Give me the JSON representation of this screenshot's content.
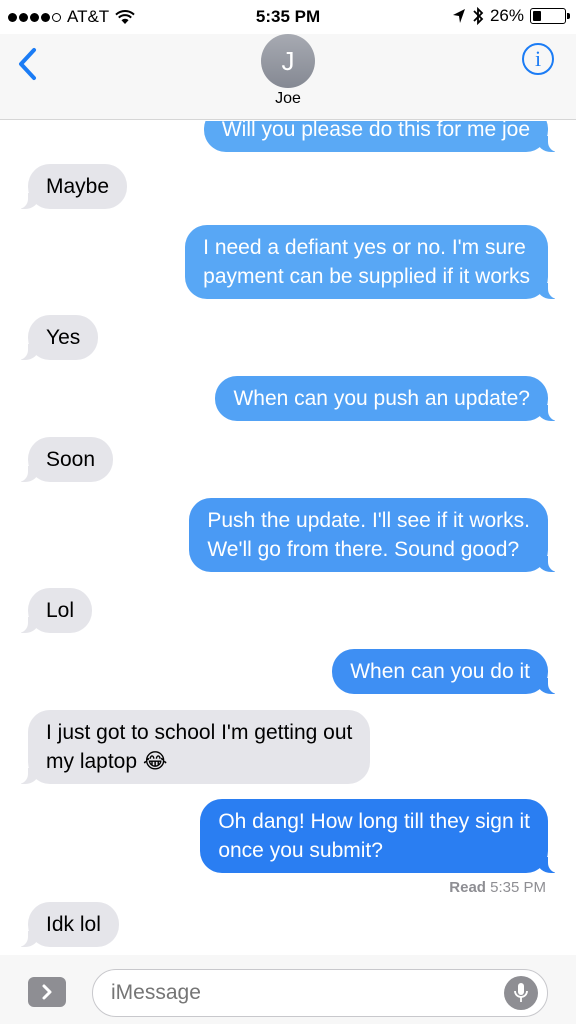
{
  "status_bar": {
    "carrier": "AT&T",
    "time": "5:35 PM",
    "battery": "26%",
    "battery_level": 0.26,
    "icons": [
      "signal-dots",
      "wifi-icon",
      "location-icon",
      "bluetooth-icon",
      "battery-icon"
    ]
  },
  "header": {
    "avatar_initial": "J",
    "contact_name": "Joe",
    "back_icon": "chevron-left-icon",
    "info_icon": "info-icon",
    "info_label": "i"
  },
  "messages": [
    {
      "direction": "out",
      "text": "Will you please do this for me joe"
    },
    {
      "direction": "in",
      "text": "Maybe"
    },
    {
      "direction": "out",
      "lines": [
        "I need a defiant yes or no. I'm sure",
        "payment can be supplied if it works"
      ]
    },
    {
      "direction": "in",
      "text": "Yes"
    },
    {
      "direction": "out",
      "text": "When can you push an update?"
    },
    {
      "direction": "in",
      "text": "Soon"
    },
    {
      "direction": "out",
      "lines": [
        "Push the update. I'll see if it works.",
        "We'll go from there. Sound good?"
      ]
    },
    {
      "direction": "in",
      "text": "Lol"
    },
    {
      "direction": "out",
      "text": "When can you do it"
    },
    {
      "direction": "in",
      "lines": [
        "I just got to school I'm getting out",
        "my laptop 😂"
      ]
    },
    {
      "direction": "out",
      "lines": [
        "Oh dang! How long till they sign it",
        "once you submit?"
      ]
    },
    {
      "direction": "in",
      "text": "Idk lol"
    }
  ],
  "read_receipt": {
    "label": "Read",
    "time": "5:35 PM"
  },
  "input": {
    "placeholder": "iMessage",
    "apps_icon": "chevron-right-icon",
    "mic_icon": "microphone-icon"
  },
  "colors": {
    "bubble_out_light": "#5aa9f5",
    "bubble_out_dark": "#2a7ef2",
    "bubble_in": "#e5e5ea",
    "accent": "#1b7cf5"
  }
}
